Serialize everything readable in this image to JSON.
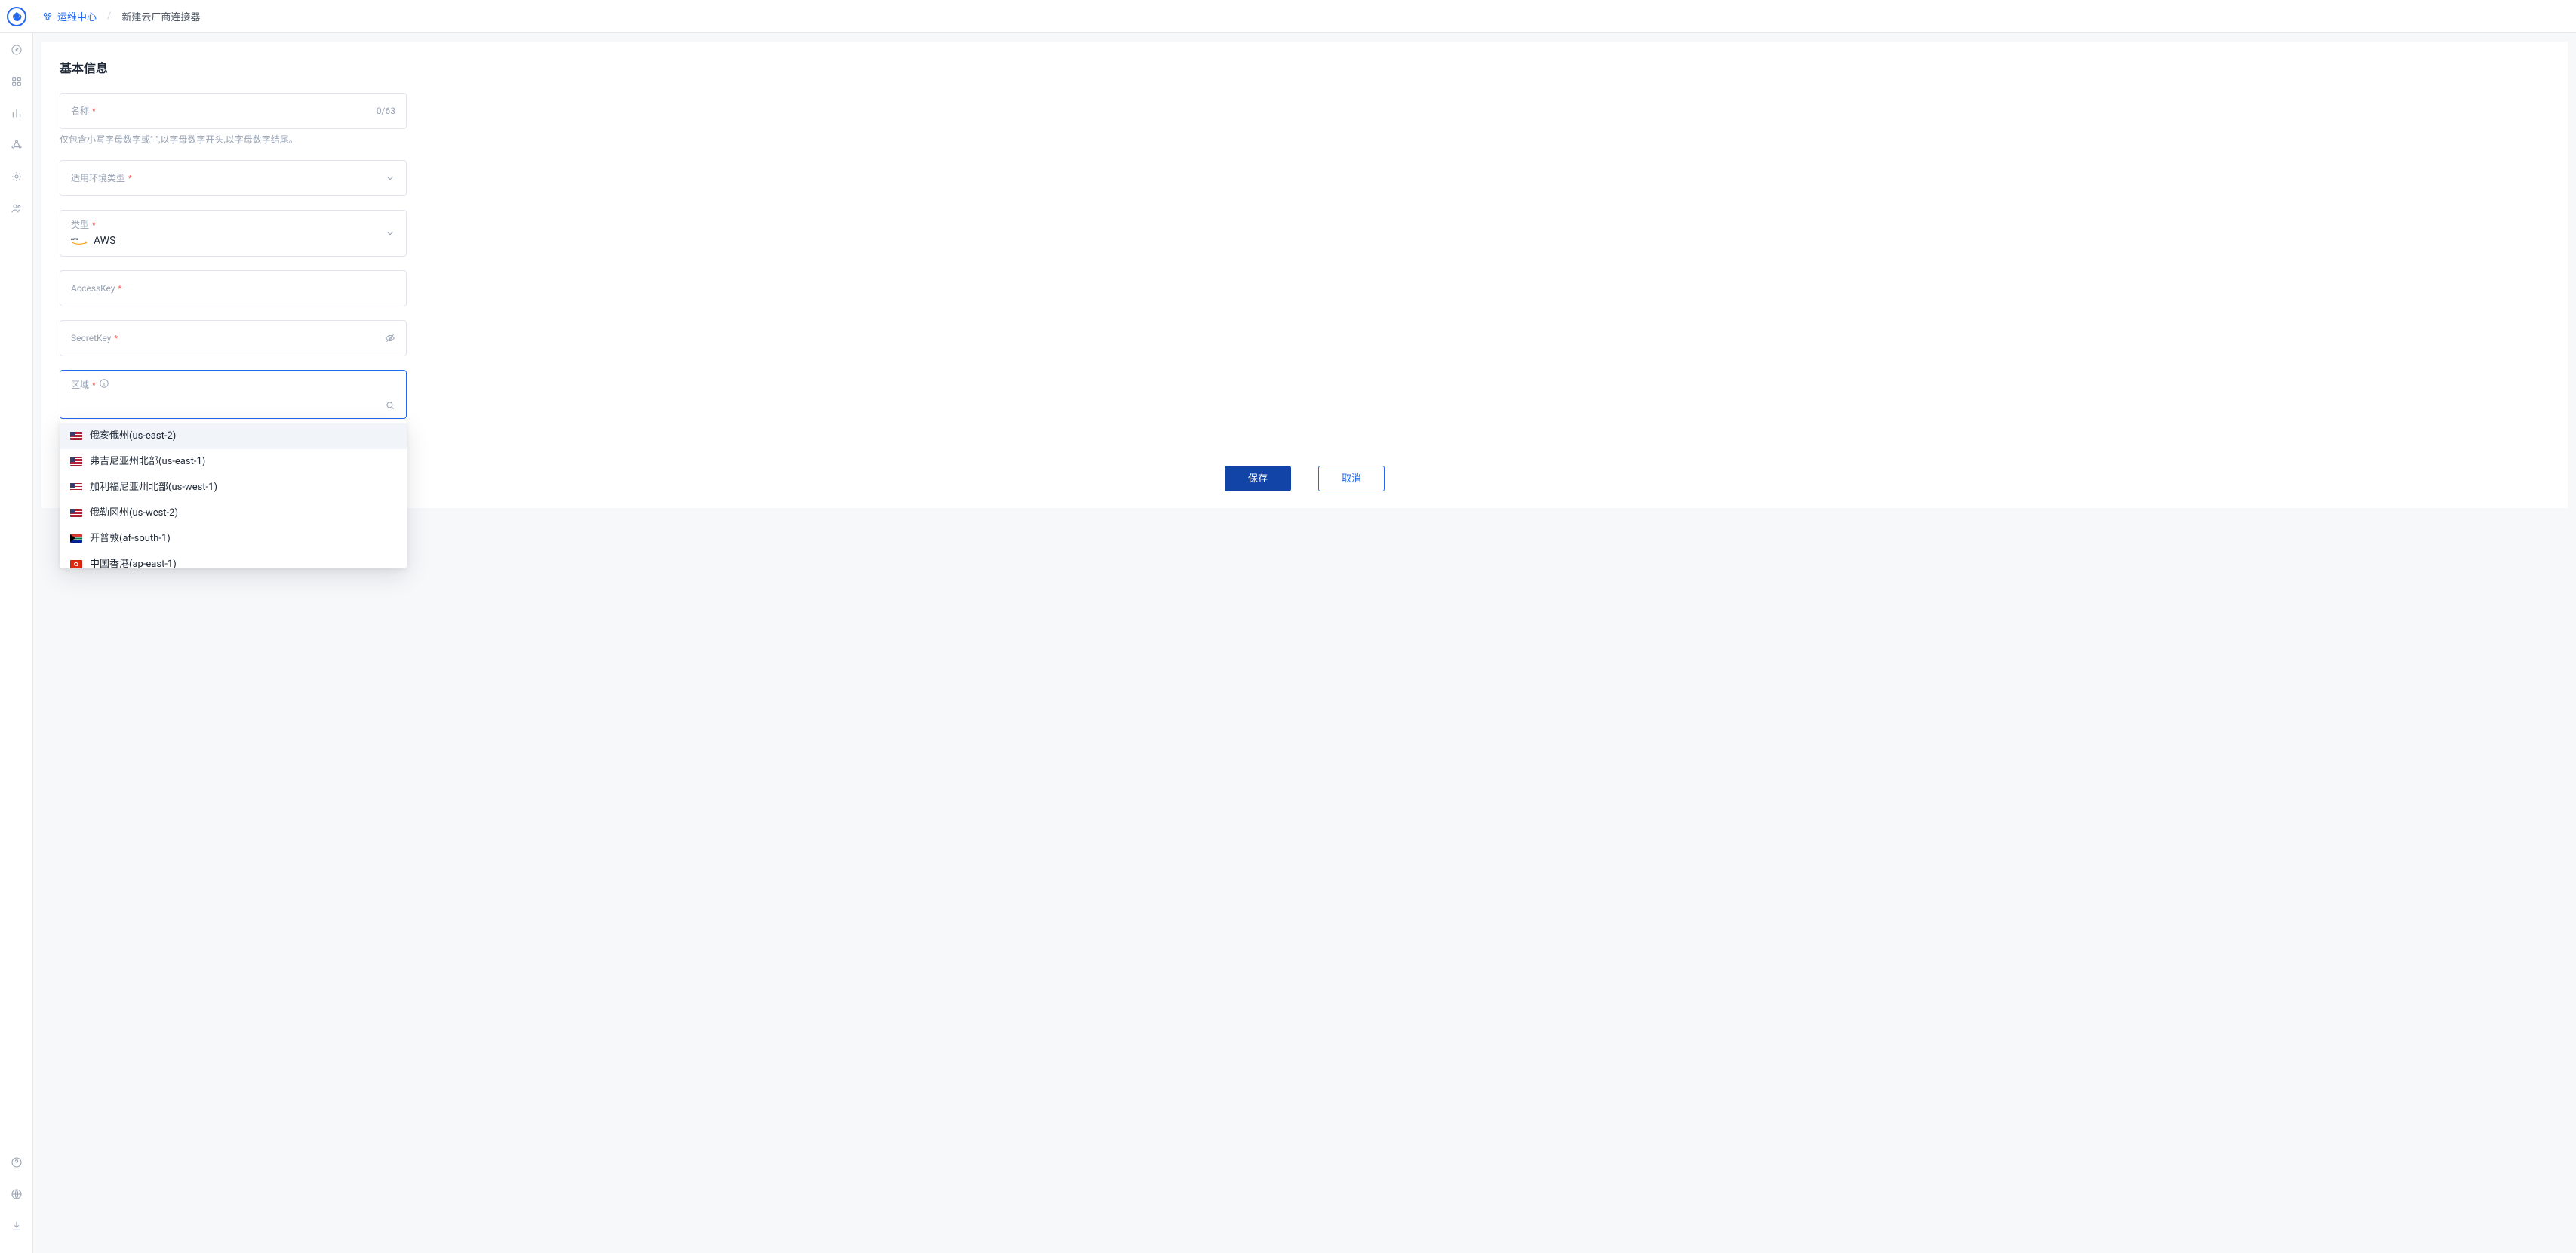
{
  "breadcrumb": {
    "root": "运维中心",
    "current": "新建云厂商连接器"
  },
  "card": {
    "title": "基本信息"
  },
  "sidebar": {
    "items": [
      "dashboard",
      "apps",
      "bar-chart",
      "circles",
      "gear",
      "users"
    ],
    "bottom": [
      "help",
      "globe",
      "download"
    ]
  },
  "form": {
    "name": {
      "label": "名称",
      "counter": "0/63",
      "hint": "仅包含小写字母数字或\"-\",以字母数字开头,以字母数字结尾。"
    },
    "envType": {
      "label": "适用环境类型"
    },
    "type": {
      "label": "类型",
      "value": "AWS"
    },
    "accessKey": {
      "label": "AccessKey"
    },
    "secretKey": {
      "label": "SecretKey"
    },
    "region": {
      "label": "区域"
    }
  },
  "regionOptions": [
    {
      "flag": "us",
      "label": "俄亥俄州(us-east-2)",
      "highlight": true
    },
    {
      "flag": "us",
      "label": "弗吉尼亚州北部(us-east-1)"
    },
    {
      "flag": "us",
      "label": "加利福尼亚州北部(us-west-1)"
    },
    {
      "flag": "us",
      "label": "俄勒冈州(us-west-2)"
    },
    {
      "flag": "za",
      "label": "开普敦(af-south-1)"
    },
    {
      "flag": "hk",
      "label": "中国香港(ap-east-1)"
    }
  ],
  "buttons": {
    "save": "保存",
    "cancel": "取消"
  }
}
